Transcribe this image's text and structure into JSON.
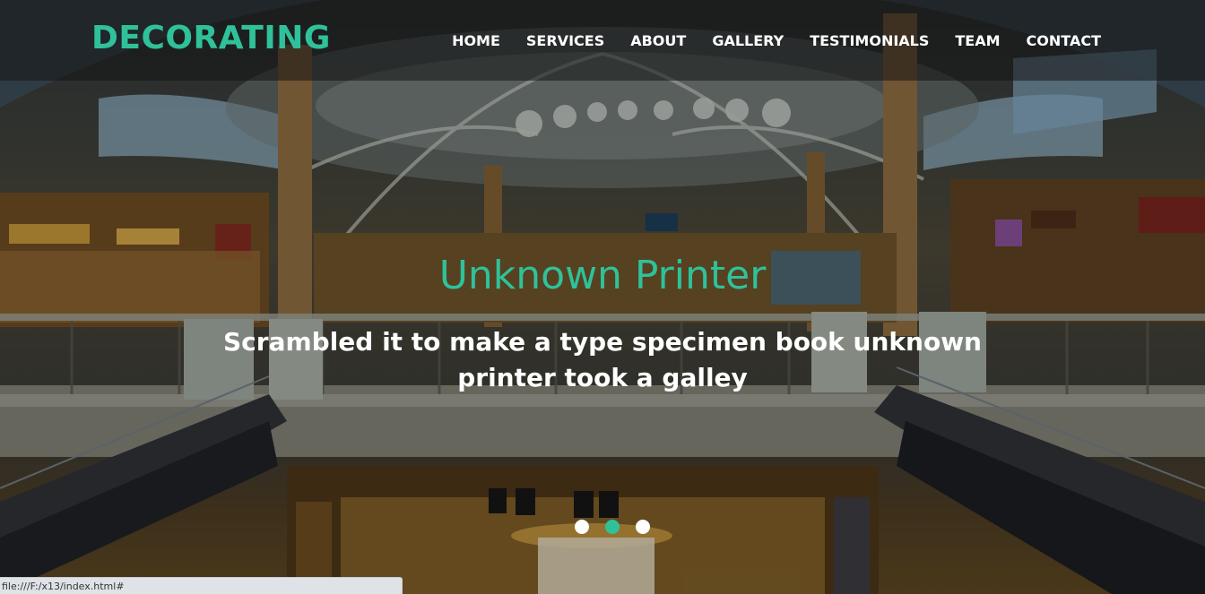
{
  "brand": {
    "logo": "DECORATING",
    "accent_color": "#2fc19a"
  },
  "nav": {
    "items": [
      {
        "label": "HOME"
      },
      {
        "label": "SERVICES"
      },
      {
        "label": "ABOUT"
      },
      {
        "label": "GALLERY"
      },
      {
        "label": "TESTIMONIALS"
      },
      {
        "label": "TEAM"
      },
      {
        "label": "CONTACT"
      }
    ]
  },
  "hero": {
    "title": "Unknown Printer",
    "subtitle": "Scrambled it to make a type specimen book unknown printer took a galley",
    "background_image": "shopping-mall-atrium",
    "slides_total": 3,
    "active_slide": 2
  },
  "status_bar": {
    "url": "file:///F:/x13/index.html#"
  }
}
